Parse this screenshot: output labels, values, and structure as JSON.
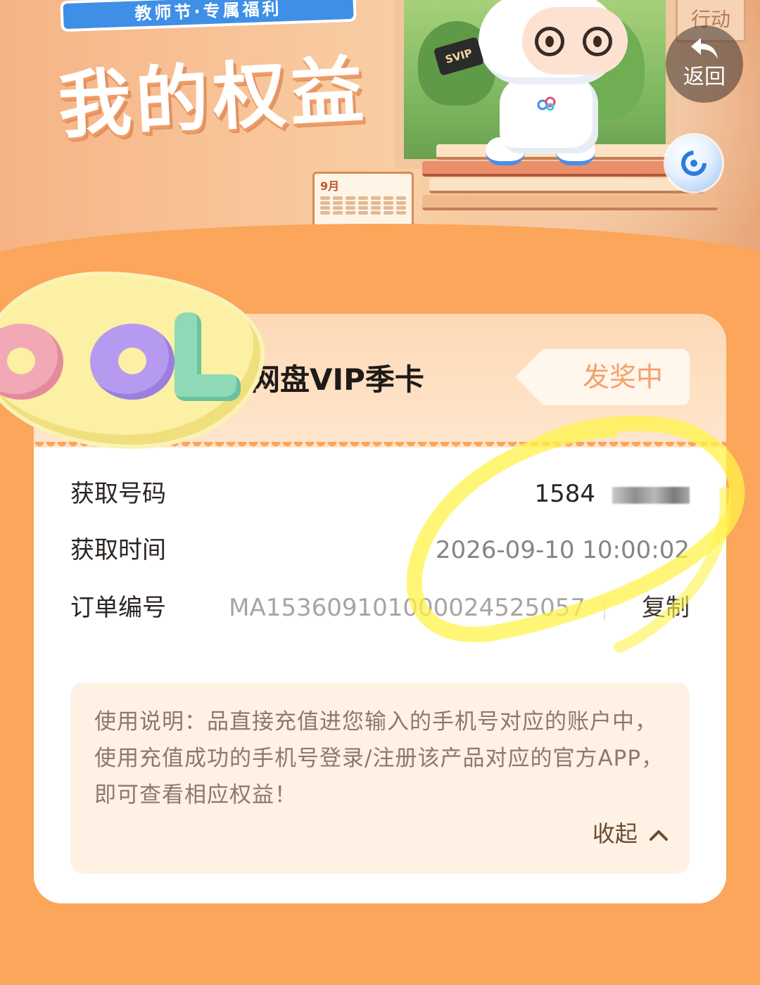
{
  "banner": {
    "badge_text": "教师节·专属福利",
    "title": "我的权益",
    "card_label": "SVIP",
    "calendar_month": "9月",
    "side_sign": "行动",
    "back_label": "返回"
  },
  "sticker": {
    "text": "COOL"
  },
  "card": {
    "product_title": "网盘VIP季卡",
    "status": "发奖中",
    "rows": [
      {
        "label": "获取号码",
        "value": "1584"
      },
      {
        "label": "获取时间",
        "value": "2026-09-10 10:00:02"
      },
      {
        "label": "订单编号",
        "value": "MA153609101000024525057"
      }
    ],
    "copy_label": "复制",
    "note": "使用说明：品直接充值进您输入的手机号对应的账户中，使用充值成功的手机号登录/注册该产品对应的官方APP，即可查看相应权益！",
    "collapse_label": "收起"
  },
  "colors": {
    "page_bg": "#fba65a",
    "status_text": "#f4a06a",
    "highlighter": "#fff34a"
  }
}
